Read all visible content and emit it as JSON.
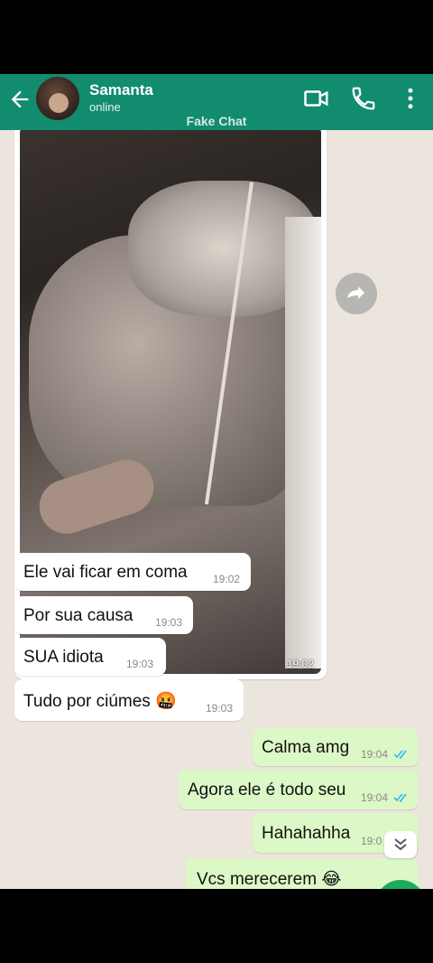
{
  "header": {
    "contact_name": "Samanta",
    "status": "online",
    "watermark": "Fake Chat",
    "icons": [
      "back-arrow-icon",
      "video-call-icon",
      "phone-icon",
      "more-vert-icon"
    ],
    "color": "#128c6e"
  },
  "photo_message": {
    "time": "19:02"
  },
  "messages": [
    {
      "text": "Ele vai ficar em coma",
      "time": "19:02",
      "direction": "in"
    },
    {
      "text": "Por sua causa",
      "time": "19:03",
      "direction": "in"
    },
    {
      "text": "SUA idiota",
      "time": "19:03",
      "direction": "in"
    },
    {
      "text": "Tudo por ciúmes 🤬",
      "time": "19:03",
      "direction": "in"
    },
    {
      "text": "Calma amg",
      "time": "19:04",
      "direction": "out"
    },
    {
      "text": "Agora ele é todo seu",
      "time": "19:04",
      "direction": "out"
    },
    {
      "text": "Hahahahha",
      "time": "19:0",
      "direction": "out"
    },
    {
      "text": "Vcs merecerem 😂",
      "time": "",
      "direction": "out"
    }
  ],
  "colors": {
    "chat_bg": "#ece5dd",
    "outgoing": "#dcf8c6",
    "incoming": "#ffffff",
    "read_ticks": "#34b7f1"
  }
}
